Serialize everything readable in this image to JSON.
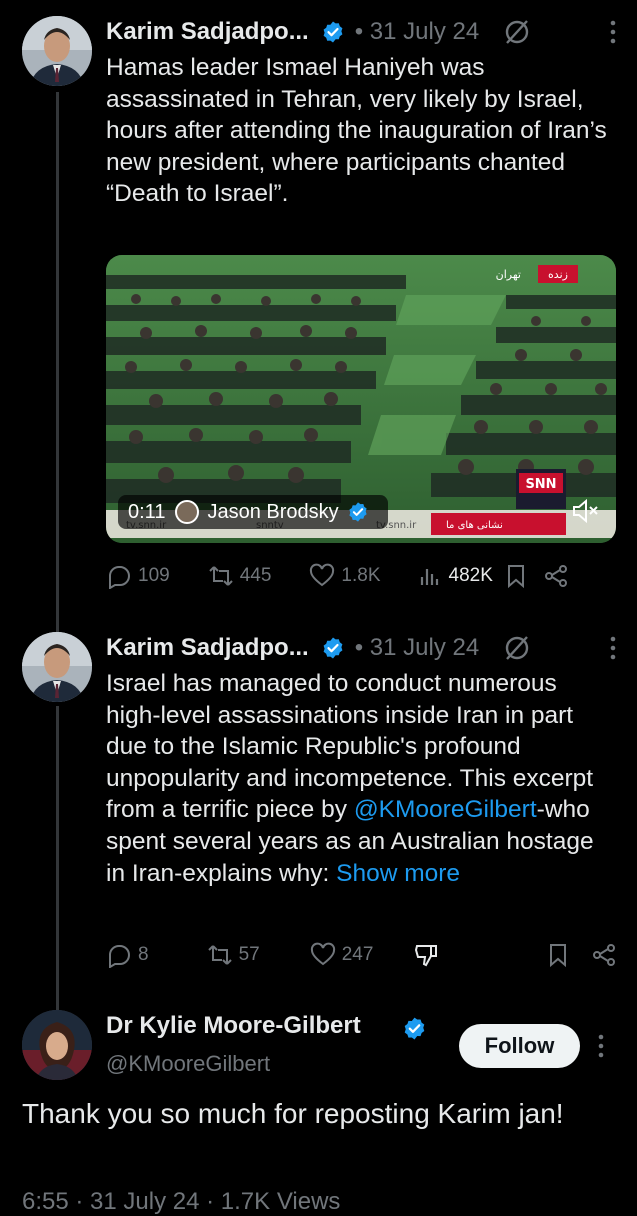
{
  "tweets": [
    {
      "author": "Karim Sadjadpo...",
      "date": "• 31 July 24",
      "text": "Hamas leader Ismael Haniyeh was assassinated in Tehran, very likely by Israel, hours after attending the inauguration of Iran’s new president, where participants chanted “Death to Israel”.",
      "video": {
        "time": "0:11",
        "attribution": "Jason Brodsky",
        "channel": "SNN",
        "overlay_tag_right": "زنده",
        "overlay_tag_left": "تهران",
        "watermark_left": "tv.snn.ir",
        "watermark_mid": "snntv",
        "watermark_right": "tv.snn.ir",
        "lower_text": "نشانی های ما"
      },
      "stats": {
        "replies": "109",
        "reposts": "445",
        "likes": "1.8K",
        "views": "482K"
      }
    },
    {
      "author": "Karim Sadjadpo...",
      "date": "• 31 July 24",
      "text_before": "Israel has managed to conduct numerous high-level assassinations inside Iran in part due to the Islamic Republic's profound unpopularity and incompetence. This excerpt from a terrific piece by ",
      "mention": "@KMooreGilbert",
      "text_after": "-who spent several years as an Australian hostage in Iran-explains why: ",
      "show_more": "Show more",
      "stats": {
        "replies": "8",
        "reposts": "57",
        "likes": "247"
      }
    },
    {
      "author": "Dr Kylie Moore-Gilbert",
      "handle": "@KMooreGilbert",
      "follow_label": "Follow",
      "text": "Thank you so much for reposting Karim jan!",
      "footer_partial": "6:55 · 31 July 24 · 1.7K Views"
    }
  ],
  "colors": {
    "background": "#000000",
    "text": "#e7e9ea",
    "muted": "#71767b",
    "link": "#1d9bf0",
    "verified": "#1d9bf0"
  }
}
